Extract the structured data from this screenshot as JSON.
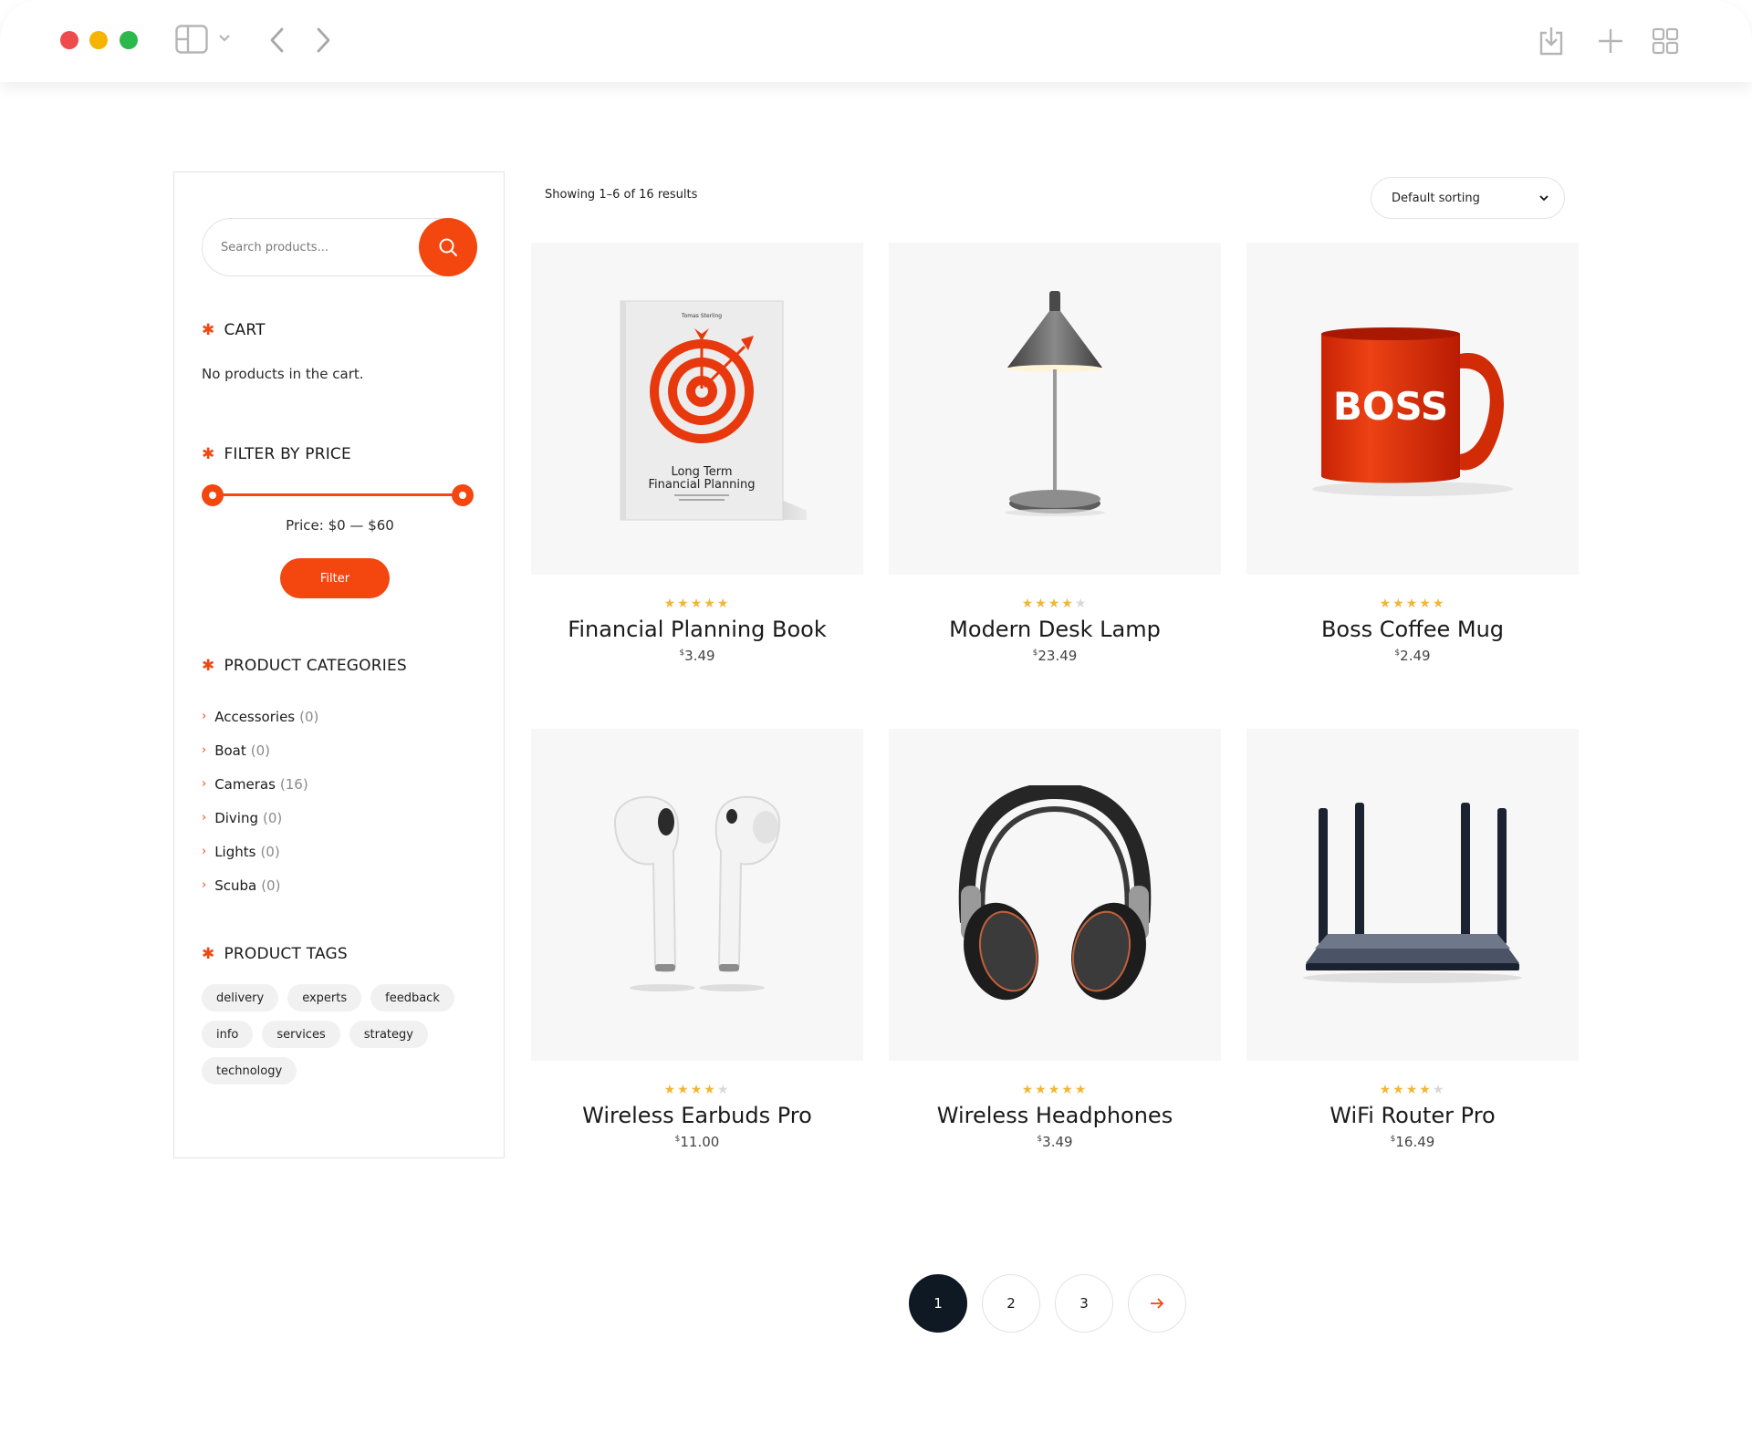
{
  "browser": {
    "icons": [
      "sidebar-toggle-icon",
      "chevron-down-icon",
      "back-icon",
      "forward-icon",
      "download-icon",
      "plus-icon",
      "tab-grid-icon"
    ]
  },
  "sidebar": {
    "search": {
      "placeholder": "Search products..."
    },
    "cart": {
      "title": "CART",
      "empty_text": "No products in the cart."
    },
    "price_filter": {
      "title": "FILTER BY PRICE",
      "min": 0,
      "max": 60,
      "range_label": "Price: $0 — $60",
      "button_label": "Filter"
    },
    "categories": {
      "title": "PRODUCT CATEGORIES",
      "items": [
        {
          "label": "Accessories",
          "count": "(0)"
        },
        {
          "label": "Boat",
          "count": "(0)"
        },
        {
          "label": "Cameras",
          "count": "(16)"
        },
        {
          "label": "Diving",
          "count": "(0)"
        },
        {
          "label": "Lights",
          "count": "(0)"
        },
        {
          "label": "Scuba",
          "count": "(0)"
        }
      ]
    },
    "tags": {
      "title": "PRODUCT TAGS",
      "items": [
        "delivery",
        "experts",
        "feedback",
        "info",
        "services",
        "strategy",
        "technology"
      ]
    }
  },
  "main": {
    "result_count": "Showing 1–6 of 16 results",
    "sorting": {
      "selected": "Default sorting"
    },
    "products": [
      {
        "name": "Financial Planning Book",
        "currency": "$",
        "price": "3.49",
        "rating": 5,
        "image": "book-image",
        "book_author": "Tomas Sterling",
        "book_title_line1": "Long Term",
        "book_title_line2": "Financial Planning"
      },
      {
        "name": "Modern Desk Lamp",
        "currency": "$",
        "price": "23.49",
        "rating": 4,
        "image": "lamp-image"
      },
      {
        "name": "Boss Coffee Mug",
        "currency": "$",
        "price": "2.49",
        "rating": 5,
        "image": "mug-image",
        "mug_text": "BOSS"
      },
      {
        "name": "Wireless Earbuds Pro",
        "currency": "$",
        "price": "11.00",
        "rating": 4,
        "image": "earbuds-image"
      },
      {
        "name": "Wireless Headphones",
        "currency": "$",
        "price": "3.49",
        "rating": 5,
        "image": "headphones-image"
      },
      {
        "name": "WiFi Router Pro",
        "currency": "$",
        "price": "16.49",
        "rating": 4,
        "image": "router-image"
      }
    ]
  },
  "pagination": {
    "pages": [
      "1",
      "2",
      "3"
    ],
    "current": "1",
    "next_icon": "arrow-right-icon"
  },
  "colors": {
    "accent": "#f3470f",
    "dark": "#0f1924",
    "star": "#f2b637"
  }
}
